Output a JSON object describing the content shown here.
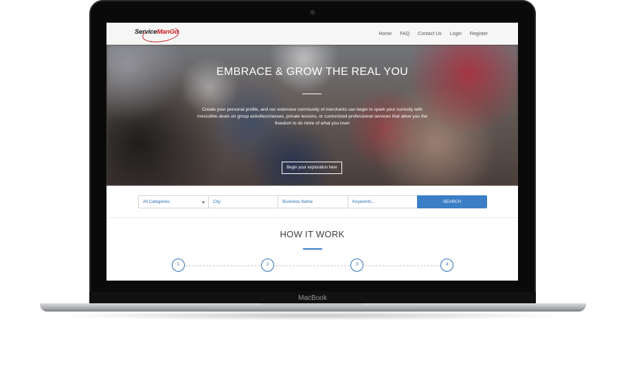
{
  "device": {
    "brand_label": "MacBook"
  },
  "site": {
    "logo": {
      "text_primary": "Service",
      "text_accent": "ManGo",
      "accent_color": "#cc1b1b"
    },
    "nav": [
      "Home",
      "FAQ",
      "Contact Us",
      "Login",
      "Register"
    ],
    "hero": {
      "title": "EMBRACE & GROW THE REAL YOU",
      "text": "Create your personal profile, and our extensive community of merchants can begin to spark your curiosity with irresistible deals on group activities/classes, private lessons, or customized professional services that allow you the freedom to do more of what you love!",
      "button_label": "Begin your exploration here"
    },
    "search": {
      "category_selected": "All Categories",
      "city_placeholder": "City",
      "business_placeholder": "Business Name",
      "keywords_placeholder": "Keywords...",
      "button_label": "SEARCH",
      "button_color": "#3b7ec5"
    },
    "how_it_works": {
      "title": "HOW IT WORK",
      "steps": [
        "1",
        "2",
        "3",
        "4"
      ]
    }
  }
}
